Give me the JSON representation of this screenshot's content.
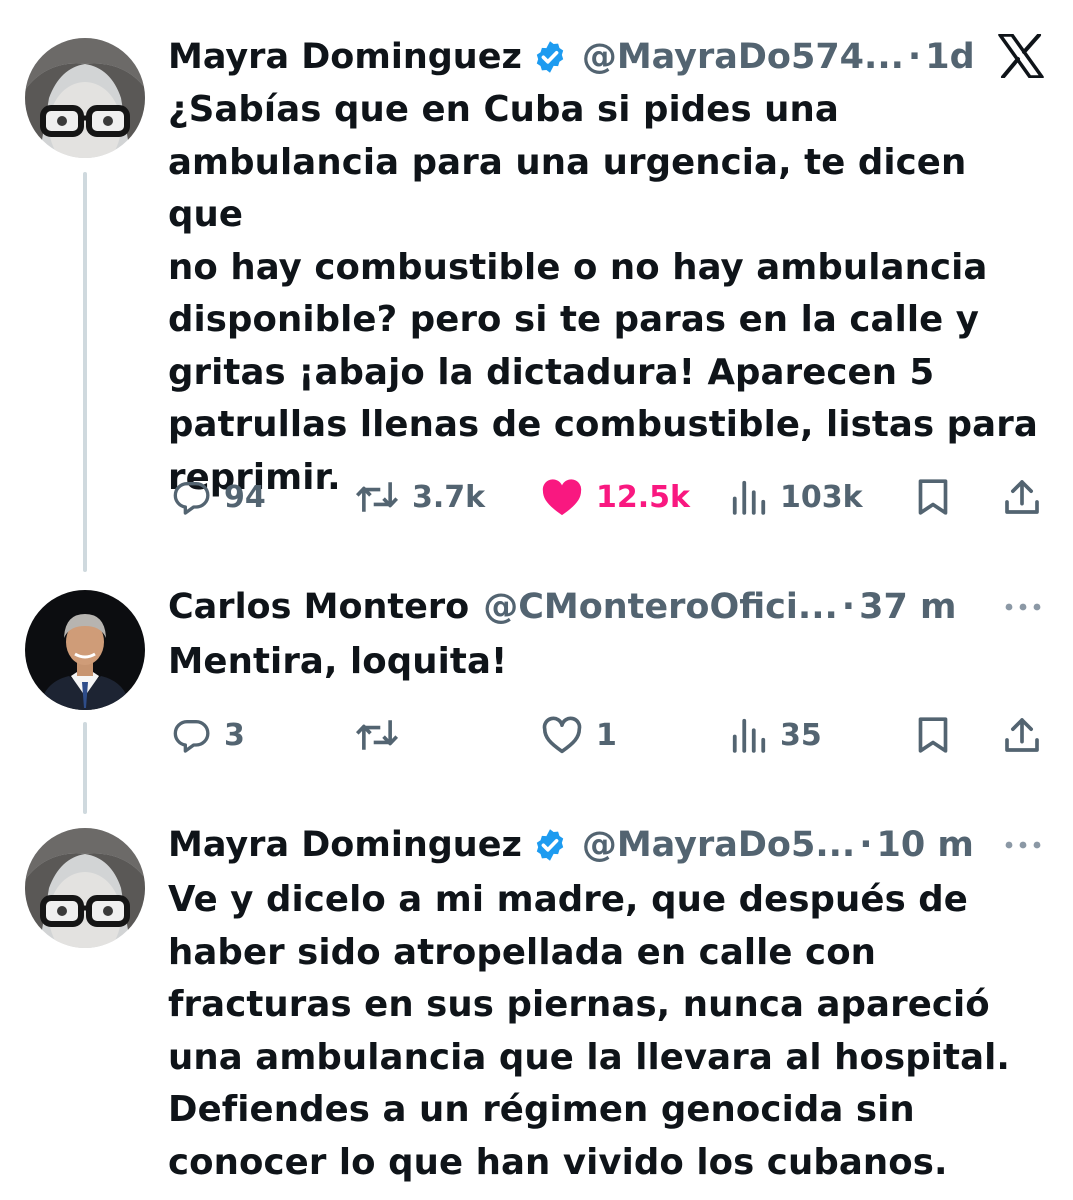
{
  "tweets": [
    {
      "author_name": "Mayra Dominguez",
      "verified": true,
      "handle": "@MayraDo574...",
      "separator": "·",
      "time": "1d",
      "text_lines": [
        "¿Sabías que en Cuba si pides una",
        "ambulancia para una urgencia, te dicen que",
        "no hay combustible o no hay ambulancia",
        "disponible? pero si te paras en la calle y",
        "gritas ¡abajo la dictadura! Aparecen 5",
        "patrullas llenas de combustible, listas para",
        "reprimir."
      ],
      "replies": "94",
      "reposts": "3.7k",
      "likes": "12.5k",
      "liked": true,
      "views": "103k"
    },
    {
      "author_name": "Carlos Montero",
      "verified": false,
      "handle": "@CMonteroOfici...",
      "separator": "·",
      "time": "37 m",
      "text_lines": [
        "Mentira, loquita!"
      ],
      "replies": "3",
      "reposts": "",
      "likes": "1",
      "liked": false,
      "views": "35"
    },
    {
      "author_name": "Mayra Dominguez",
      "verified": true,
      "handle": "@MayraDo5...",
      "separator": "·",
      "time": "10 m",
      "text_lines": [
        "Ve y dicelo a mi madre, que después de",
        "haber sido atropellada en calle con",
        "fracturas en sus piernas, nunca apareció",
        "una ambulancia que la llevara al hospital.",
        "Defiendes a un régimen genocida sin",
        "conocer lo que han vivido los cubanos."
      ]
    }
  ],
  "icons": {
    "platform_logo": "x-logo",
    "verified": "verified-badge-icon",
    "more": "more-icon",
    "reply": "reply-icon",
    "repost": "repost-icon",
    "like": "heart-icon",
    "views": "views-icon",
    "bookmark": "bookmark-icon",
    "share": "share-icon"
  },
  "colors": {
    "text": "#0f1419",
    "secondary": "#536471",
    "verified_blue": "#1d9bf0",
    "like_pink": "#f91880",
    "thread_line": "#cfd9de"
  }
}
